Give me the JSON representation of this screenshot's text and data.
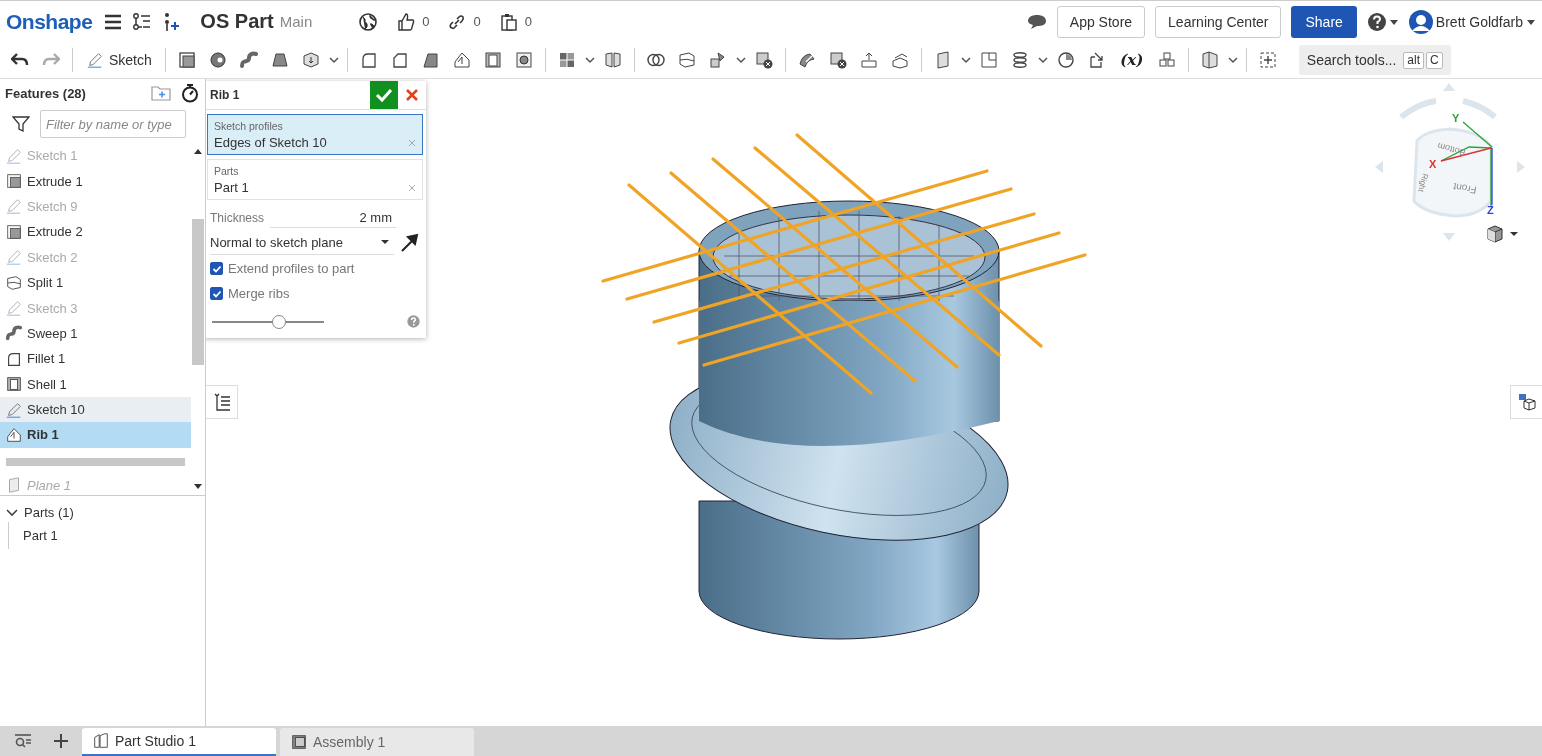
{
  "topbar": {
    "logo": "Onshape",
    "document_title": "OS Part",
    "branch": "Main",
    "counts": [
      {
        "kind": "likes",
        "value": "0"
      },
      {
        "kind": "links",
        "value": "0"
      },
      {
        "kind": "copies",
        "value": "0"
      }
    ],
    "buttons": [
      "App Store",
      "Learning Center"
    ],
    "share": "Share",
    "user": "Brett Goldfarb"
  },
  "toolbar": {
    "sketch": "Sketch",
    "variable_tool": "(x)",
    "search": "Search tools...",
    "shortcut": [
      "alt",
      "C"
    ]
  },
  "features": {
    "title": "Features (28)",
    "filter_placeholder": "Filter by name or type",
    "items": [
      {
        "label": "Sketch 1",
        "kind": "sketch",
        "dimmed": true,
        "highlighted": false,
        "selected": false
      },
      {
        "label": "Extrude 1",
        "kind": "extrude",
        "dimmed": false,
        "highlighted": false,
        "selected": false
      },
      {
        "label": "Sketch 9",
        "kind": "sketch",
        "dimmed": true,
        "highlighted": false,
        "selected": false
      },
      {
        "label": "Extrude 2",
        "kind": "extrude",
        "dimmed": false,
        "highlighted": false,
        "selected": false
      },
      {
        "label": "Sketch 2",
        "kind": "sketch",
        "dimmed": true,
        "highlighted": false,
        "selected": false
      },
      {
        "label": "Split 1",
        "kind": "split",
        "dimmed": false,
        "highlighted": false,
        "selected": false
      },
      {
        "label": "Sketch 3",
        "kind": "sketch",
        "dimmed": true,
        "highlighted": false,
        "selected": false
      },
      {
        "label": "Sweep 1",
        "kind": "sweep",
        "dimmed": false,
        "highlighted": false,
        "selected": false
      },
      {
        "label": "Fillet 1",
        "kind": "fillet",
        "dimmed": false,
        "highlighted": false,
        "selected": false
      },
      {
        "label": "Shell 1",
        "kind": "shell",
        "dimmed": false,
        "highlighted": false,
        "selected": false
      },
      {
        "label": "Sketch 10",
        "kind": "sketch",
        "dimmed": false,
        "highlighted": true,
        "selected": false
      },
      {
        "label": "Rib 1",
        "kind": "rib",
        "dimmed": false,
        "highlighted": false,
        "selected": true
      }
    ],
    "after_rollback": [
      {
        "label": "Plane 1",
        "kind": "plane"
      }
    ],
    "parts": {
      "title": "Parts (1)",
      "expanded": true,
      "items": [
        "Part 1"
      ]
    }
  },
  "dialog": {
    "title": "Rib 1",
    "fields": [
      {
        "label": "Sketch profiles",
        "value": "Edges of Sketch 10",
        "selected": true
      },
      {
        "label": "Parts",
        "value": "Part 1",
        "selected": false
      }
    ],
    "thickness_label": "Thickness",
    "thickness": "2 mm",
    "direction": "Normal to sketch plane",
    "checks": [
      {
        "label": "Extend profiles to part",
        "checked": true
      },
      {
        "label": "Merge ribs",
        "checked": true
      }
    ],
    "slider": {
      "level": 0.6
    }
  },
  "view_cube": {
    "axes": [
      "Y",
      "X",
      "Z"
    ],
    "faces": [
      "Bottom",
      "Right",
      "Front"
    ]
  },
  "tabs": [
    {
      "label": "Part Studio 1",
      "kind": "partstudio",
      "selected": true
    },
    {
      "label": "Assembly 1",
      "kind": "assembly",
      "selected": false
    }
  ]
}
